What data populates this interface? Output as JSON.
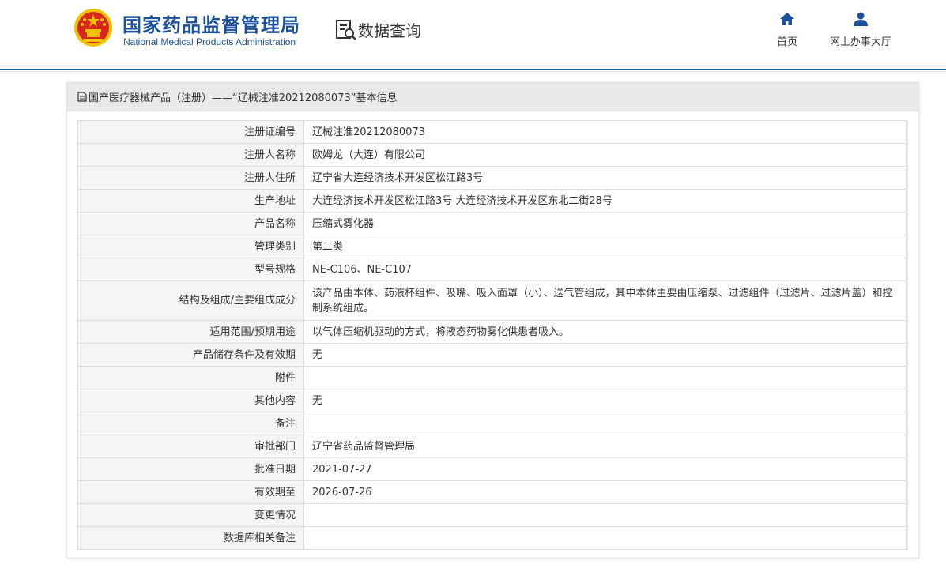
{
  "header": {
    "site_name_cn": "国家药品监督管理局",
    "site_name_en": "National Medical Products Administration",
    "section_label": "数据查询",
    "nav": {
      "home_label": "首页",
      "hall_label": "网上办事大厅"
    }
  },
  "panel": {
    "title": "国产医疗器械产品（注册）——“辽械注准20212080073”基本信息",
    "rows": [
      {
        "label": "注册证编号",
        "value": "辽械注准20212080073"
      },
      {
        "label": "注册人名称",
        "value": "欧姆龙（大连）有限公司"
      },
      {
        "label": "注册人住所",
        "value": "辽宁省大连经济技术开发区松江路3号"
      },
      {
        "label": "生产地址",
        "value": "大连经济技术开发区松江路3号 大连经济技术开发区东北二街28号"
      },
      {
        "label": "产品名称",
        "value": "压缩式雾化器"
      },
      {
        "label": "管理类别",
        "value": "第二类"
      },
      {
        "label": "型号规格",
        "value": "NE-C106、NE-C107"
      },
      {
        "label": "结构及组成/主要组成成分",
        "value": "该产品由本体、药液杯组件、吸嘴、吸入面罩（小）、送气管组成，其中本体主要由压缩泵、过滤组件（过滤片、过滤片盖）和控制系统组成。"
      },
      {
        "label": "适用范围/预期用途",
        "value": "以气体压缩机驱动的方式，将液态药物雾化供患者吸入。"
      },
      {
        "label": "产品储存条件及有效期",
        "value": "无"
      },
      {
        "label": "附件",
        "value": ""
      },
      {
        "label": "其他内容",
        "value": "无"
      },
      {
        "label": "备注",
        "value": ""
      },
      {
        "label": "审批部门",
        "value": "辽宁省药品监督管理局"
      },
      {
        "label": "批准日期",
        "value": "2021-07-27"
      },
      {
        "label": "有效期至",
        "value": "2026-07-26"
      },
      {
        "label": "变更情况",
        "value": ""
      },
      {
        "label": "数据库相关备注",
        "value": ""
      }
    ]
  },
  "colors": {
    "brand_blue": "#1c4f9c",
    "emblem_red": "#d7261e",
    "emblem_gold": "#f2c200"
  }
}
